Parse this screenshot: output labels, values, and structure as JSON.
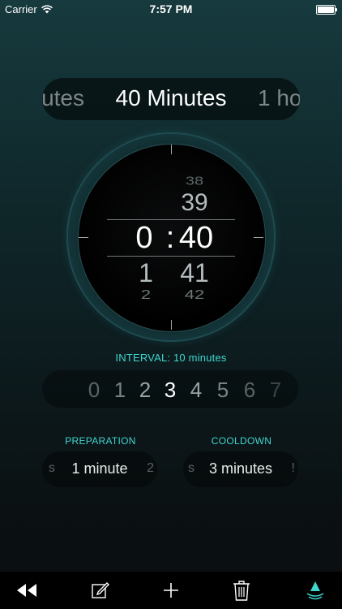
{
  "status": {
    "carrier": "Carrier",
    "time": "7:57 PM"
  },
  "duration": {
    "prev": "utes",
    "current": "40 Minutes",
    "next": "1 ho"
  },
  "dial": {
    "hour_current": "0",
    "hour_next": "1",
    "hour_next2": "2",
    "separator": ":",
    "minute_prev2": "38",
    "minute_prev": "39",
    "minute_current": "40",
    "minute_next": "41",
    "minute_next2": "42"
  },
  "interval": {
    "label": "INTERVAL: 10 minutes",
    "digits": [
      "0",
      "1",
      "2",
      "3",
      "4",
      "5",
      "6",
      "7"
    ],
    "selected": "3"
  },
  "preparation": {
    "label": "PREPARATION",
    "value": "1 minute",
    "prev_edge": "s",
    "next_edge": "2"
  },
  "cooldown": {
    "label": "COOLDOWN",
    "value": "3 minutes",
    "prev_edge": "s",
    "next_edge": "!"
  },
  "toolbar": {
    "icons": [
      "rewind-icon",
      "edit-icon",
      "add-icon",
      "trash-icon",
      "water-level-icon"
    ],
    "accent": "#3fd6d0"
  }
}
